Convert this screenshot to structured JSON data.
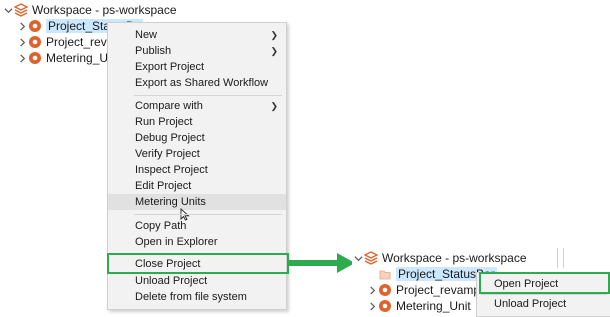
{
  "tree": {
    "workspace_label": "Workspace - ps-workspace",
    "projects": [
      {
        "label": "Project_StatusBar",
        "shown": "Project_StatusBa",
        "selected": true
      },
      {
        "label": "Project_revamp",
        "shown": "Project_reva",
        "selected": false
      },
      {
        "label": "Metering_Units",
        "shown": "Metering_Uni",
        "selected": false
      }
    ]
  },
  "context_menu": {
    "items": [
      {
        "label": "New",
        "submenu": true
      },
      {
        "label": "Publish",
        "submenu": true
      },
      {
        "label": "Export Project",
        "submenu": false
      },
      {
        "label": "Export as Shared Workflow",
        "submenu": false
      },
      {
        "label": "Compare with",
        "submenu": true
      },
      {
        "label": "Run Project",
        "submenu": false
      },
      {
        "label": "Debug Project",
        "submenu": false
      },
      {
        "label": "Verify Project",
        "submenu": false
      },
      {
        "label": "Inspect Project",
        "submenu": false
      },
      {
        "label": "Edit Project",
        "submenu": false
      },
      {
        "label": "Metering Units",
        "submenu": false
      },
      {
        "label": "Copy Path",
        "submenu": false
      },
      {
        "label": "Open in Explorer",
        "submenu": false
      },
      {
        "label": "Close Project",
        "submenu": false
      },
      {
        "label": "Unload Project",
        "submenu": false
      },
      {
        "label": "Delete from file system",
        "submenu": false
      }
    ],
    "hovered": "Metering Units",
    "highlighted": "Close Project"
  },
  "result_view": {
    "workspace_label": "Workspace - ps-workspace",
    "projects": [
      {
        "label": "Project_StatusBar",
        "shown": "Project_StatusBar",
        "closed": true
      },
      {
        "label": "Project_revamp",
        "shown": "Project_revamp"
      },
      {
        "label": "Metering_Units",
        "shown": "Metering_Unit"
      }
    ],
    "context_menu": {
      "items": [
        "Open Project",
        "Unload Project"
      ],
      "highlighted": "Open Project"
    }
  },
  "colors": {
    "accent_green": "#2eaa4f",
    "project_icon": "#e0622b",
    "selection": "#cce8ff"
  },
  "icons": {
    "expand": "chevron-down-icon",
    "collapsed": "chevron-right-icon",
    "workspace": "workspace-stack-icon",
    "project": "project-icon",
    "submenu": "chevron-right-icon",
    "cursor": "mouse-cursor-icon"
  }
}
